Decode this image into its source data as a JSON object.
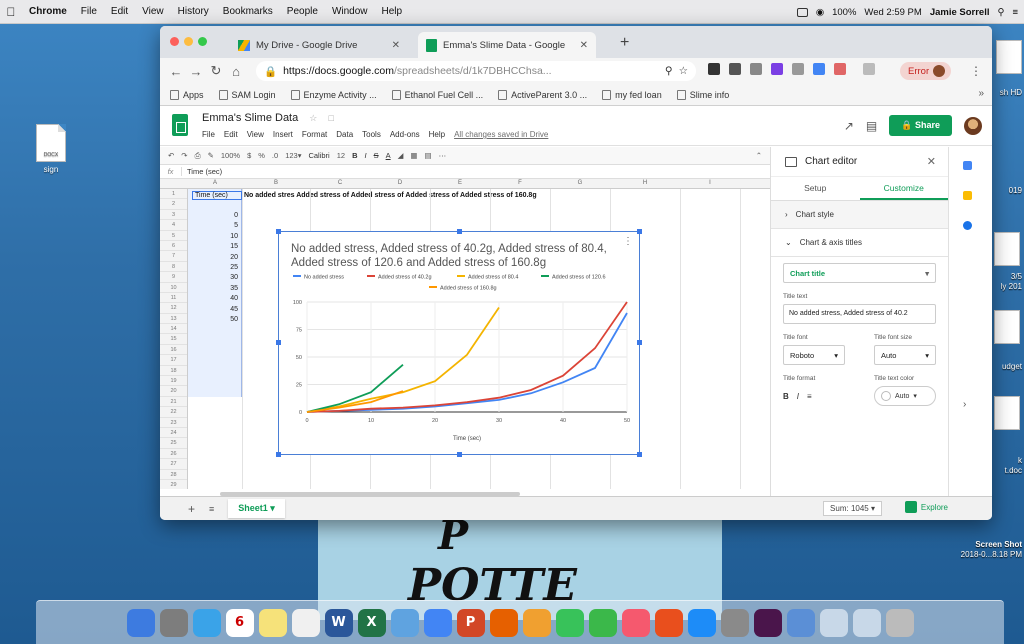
{
  "menubar": {
    "items": [
      "Chrome",
      "File",
      "Edit",
      "View",
      "History",
      "Bookmarks",
      "People",
      "Window",
      "Help"
    ],
    "battery": "100%",
    "datetime": "Wed 2:59 PM",
    "user": "Jamie Sorrell"
  },
  "desktop": {
    "left_icon_label": "sign",
    "left_icon_type": "DOCX",
    "right_labels": [
      "sh HD",
      "019",
      "3/5",
      "ly 201",
      "udget",
      "k",
      "t.doc",
      "Screen Shot",
      "2018-0...8.18 PM"
    ]
  },
  "background_text": {
    "line1": "P",
    "line2": "POTTE"
  },
  "browser": {
    "tabs": [
      {
        "title": "My Drive - Google Drive",
        "icon": "drive-icon"
      },
      {
        "title": "Emma's Slime Data - Google",
        "icon": "sheets-icon"
      }
    ],
    "url_host": "https://docs.google.com",
    "url_path": "/spreadsheets/d/1k7DBHCChsa...",
    "error_label": "Error",
    "bookmarks": [
      "Apps",
      "SAM Login",
      "Enzyme Activity ...",
      "Ethanol Fuel Cell ...",
      "ActiveParent 3.0 ...",
      "my fed loan",
      "Slime info"
    ]
  },
  "doc": {
    "title": "Emma's Slime Data",
    "menus": [
      "File",
      "Edit",
      "View",
      "Insert",
      "Format",
      "Data",
      "Tools",
      "Add-ons",
      "Help"
    ],
    "saved_status": "All changes saved in Drive",
    "share_label": "Share",
    "zoom": "100%",
    "font": "Calibri",
    "font_size": "12",
    "formula_label": "fx",
    "formula_value": "Time (sec)",
    "columns": [
      "A",
      "B",
      "C",
      "D",
      "E",
      "F",
      "G",
      "H",
      "I"
    ],
    "row_numbers": [
      "1",
      "2",
      "3",
      "4",
      "5",
      "6",
      "7",
      "8",
      "9",
      "10",
      "11",
      "12",
      "13",
      "14",
      "15",
      "16",
      "17",
      "18",
      "19",
      "20",
      "21",
      "22",
      "23",
      "24",
      "25",
      "26",
      "27",
      "28",
      "29"
    ],
    "header_a1": "Time (sec)",
    "header_rest": "No added stres Added stress of Added stress of Added stress of Added stress of 160.8g",
    "times": [
      "0",
      "5",
      "10",
      "15",
      "20",
      "25",
      "30",
      "35",
      "40",
      "45",
      "50"
    ],
    "sheet_tab": "Sheet1",
    "sum_label": "Sum: 1045",
    "explore_label": "Explore"
  },
  "editor": {
    "title": "Chart editor",
    "tabs": [
      "Setup",
      "Customize"
    ],
    "sections": [
      "Chart style",
      "Chart & axis titles"
    ],
    "title_select": "Chart title",
    "title_text_label": "Title text",
    "title_text_value": "No added stress, Added stress of 40.2",
    "title_font_label": "Title font",
    "title_font_value": "Roboto",
    "title_size_label": "Title font size",
    "title_size_value": "Auto",
    "title_format_label": "Title format",
    "title_color_label": "Title text color",
    "title_color_value": "Auto"
  },
  "chart_data": {
    "type": "line",
    "title": "No added stress, Added stress of 40.2g, Added stress of 80.4, Added stress of 120.6 and Added stress of 160.8g",
    "title_line1": "No added stress, Added stress of 40.2g, Added stress of 80.4,",
    "title_line2": "Added stress of 120.6 and Added stress of 160.8g",
    "xlabel": "Time (sec)",
    "ylabel": "",
    "xlim": [
      0,
      50
    ],
    "ylim": [
      0,
      100
    ],
    "x_ticks": [
      "0",
      "10",
      "20",
      "30",
      "40",
      "50"
    ],
    "y_ticks": [
      "0",
      "25",
      "50",
      "75",
      "100"
    ],
    "grid": true,
    "legend_position": "top",
    "series": [
      {
        "name": "No added stress",
        "color": "#4285f4",
        "x": [
          0,
          5,
          10,
          15,
          20,
          25,
          30,
          35,
          40,
          45,
          50
        ],
        "y": [
          0,
          1,
          2,
          3,
          5,
          8,
          11,
          17,
          27,
          40,
          90
        ]
      },
      {
        "name": "Added stress of 40.2g",
        "color": "#db4437",
        "x": [
          0,
          5,
          10,
          15,
          20,
          25,
          30,
          35,
          40,
          45,
          50
        ],
        "y": [
          0,
          1,
          3,
          4,
          6,
          9,
          13,
          20,
          33,
          58,
          100
        ]
      },
      {
        "name": "Added stress of 80.4",
        "color": "#f4b400",
        "x": [
          0,
          5,
          10,
          15,
          20,
          25,
          30
        ],
        "y": [
          0,
          5,
          12,
          18,
          28,
          52,
          95
        ]
      },
      {
        "name": "Added stress of 120.6",
        "color": "#0f9d58",
        "x": [
          0,
          5,
          10,
          15
        ],
        "y": [
          0,
          7,
          18,
          43
        ]
      },
      {
        "name": "Added stress of 160.8g",
        "color": "#ff9800",
        "x": [
          0,
          5,
          10,
          15
        ],
        "y": [
          0,
          4,
          9,
          19
        ]
      }
    ]
  },
  "dock": {
    "apps": [
      "finder-app",
      "launchpad-app",
      "safari-app",
      "calendar-app",
      "notes-app",
      "reminders-app",
      "word-app",
      "excel-app",
      "preview-app",
      "chrome-app",
      "powerpoint-app",
      "firefox-app",
      "photos-app",
      "messages-app",
      "facetime-app",
      "itunes-app",
      "office-app",
      "appstore-app",
      "sysprefs-app",
      "slack-app",
      "mail-app",
      "downloads-stack",
      "documents-stack",
      "trash-app"
    ],
    "app_letters": {
      "word-app": "W",
      "excel-app": "X",
      "powerpoint-app": "P",
      "calendar-app": "6"
    }
  }
}
